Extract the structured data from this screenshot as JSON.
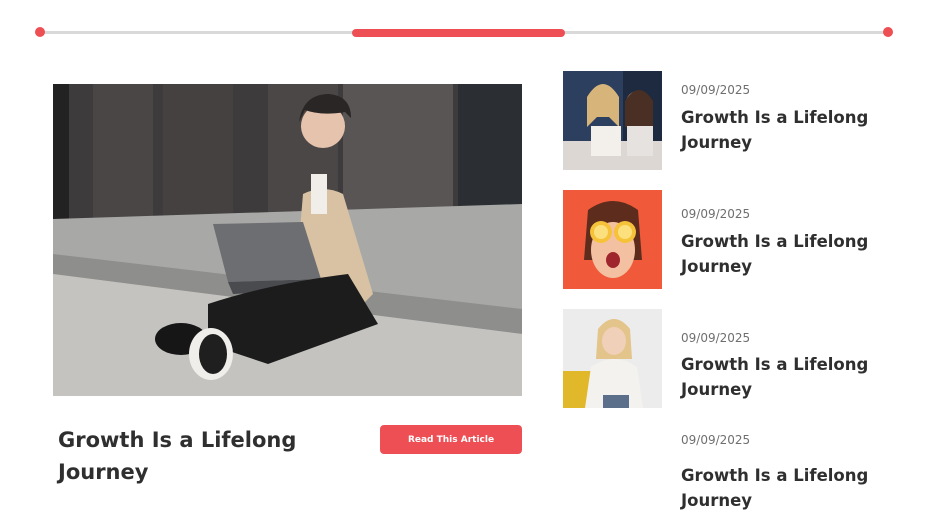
{
  "slider": {
    "progress": 0.25
  },
  "featured": {
    "title": "Growth Is a Lifelong Journey",
    "button_label": "Read This Article"
  },
  "side_articles": [
    {
      "date": "09/09/2025",
      "title": "Growth Is a Lifelong Journey"
    },
    {
      "date": "09/09/2025",
      "title": "Growth Is a Lifelong Journey"
    },
    {
      "date": "09/09/2025",
      "title": "Growth Is a Lifelong Journey"
    },
    {
      "date": "09/09/2025",
      "title": "Growth Is a Lifelong Journey"
    }
  ],
  "colors": {
    "accent": "#ee4f55",
    "track": "#d9d9d9",
    "text": "#2f2f2f",
    "muted": "#6f6f6f"
  }
}
